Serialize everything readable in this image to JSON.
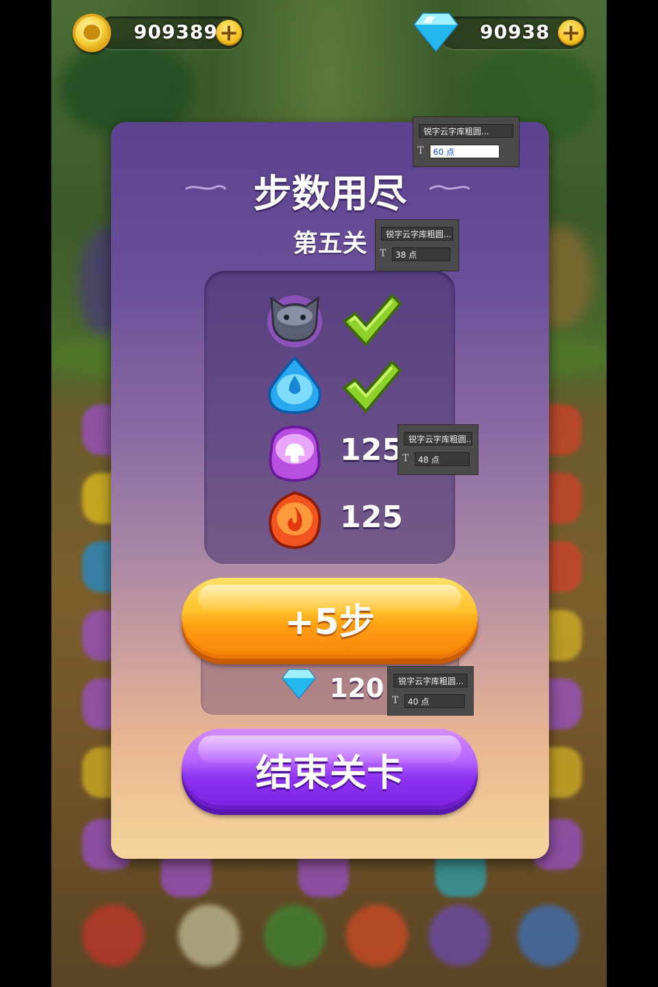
{
  "top_bar": {
    "coins_value": "909389",
    "gems_value": "90938",
    "coins_add_icon": "plus-icon",
    "gems_add_icon": "plus-icon"
  },
  "dialog": {
    "title": "步数用尽",
    "level_label": "第五关",
    "goals": [
      {
        "icon": "cat-head-icon",
        "status": "complete"
      },
      {
        "icon": "water-drop-icon",
        "status": "complete"
      },
      {
        "icon": "purple-mushroom-icon",
        "count": "125"
      },
      {
        "icon": "fire-gem-icon",
        "count": "125"
      }
    ],
    "buy_steps_label": "+5步",
    "buy_steps_cost": "120",
    "end_level_label": "结束关卡"
  },
  "font_panels": [
    {
      "font": "锐字云字库粗圆...",
      "size": "60 点"
    },
    {
      "font": "锐字云字库粗圆...",
      "size": "38 点"
    },
    {
      "font": "锐字云字库粗圆...",
      "size": "48 点"
    },
    {
      "font": "锐字云字库粗圆...",
      "size": "40 点"
    }
  ],
  "colors": {
    "dialog_top": "#5b4390",
    "dialog_bottom": "#f5d59c",
    "orange_button": "#ff9e12",
    "purple_button": "#8d33f0"
  }
}
